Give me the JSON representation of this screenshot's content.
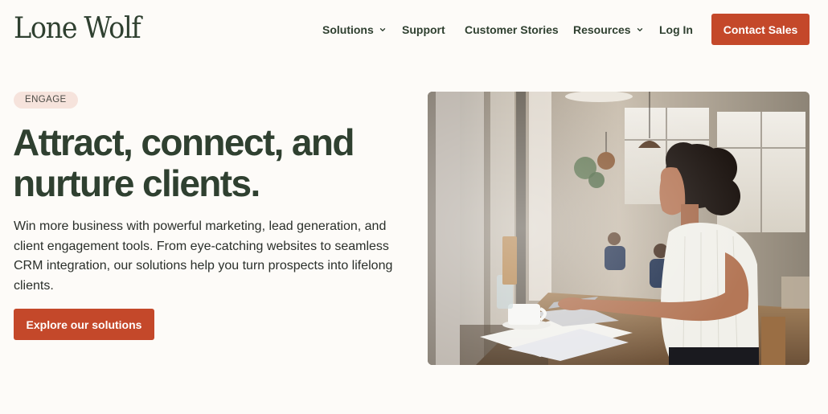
{
  "brand": {
    "logo_text": "Lone Wolf",
    "accent_color": "#c4482a",
    "text_color": "#2f4030"
  },
  "nav": {
    "items": [
      {
        "label": "Solutions",
        "has_dropdown": true
      },
      {
        "label": "Support",
        "has_dropdown": false
      },
      {
        "label": "Customer Stories",
        "has_dropdown": false
      },
      {
        "label": "Resources",
        "has_dropdown": true
      },
      {
        "label": "Log In",
        "has_dropdown": false
      }
    ],
    "cta_label": "Contact Sales"
  },
  "hero": {
    "badge": "ENGAGE",
    "headline": "Attract, connect, and nurture clients.",
    "subtext": "Win more business with powerful marketing, lead generation, and client engagement tools. From eye-catching websites to seamless CRM integration, our solutions help you turn prospects into lifelong clients.",
    "cta_label": "Explore our solutions",
    "badge_color": "#f6e3dc"
  },
  "icons": {
    "dropdown": "chevron-down-icon"
  }
}
